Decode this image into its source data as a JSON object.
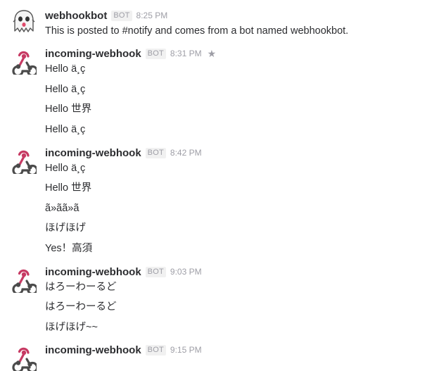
{
  "messages": [
    {
      "sender": "webhookbot",
      "badge": "BOT",
      "time": "8:25 PM",
      "avatar_icon": "ghost-icon",
      "lines": [
        "This is posted to #notify and comes from a bot named webhookbot."
      ]
    },
    {
      "sender": "incoming-webhook",
      "badge": "BOT",
      "time": "8:31 PM",
      "avatar_icon": "webhook-icon",
      "star_icon": "star-icon",
      "lines": [
        "Hello ä¸ç",
        "Hello ä¸ç",
        "Hello 世界",
        "Hello ä¸ç"
      ]
    },
    {
      "sender": "incoming-webhook",
      "badge": "BOT",
      "time": "8:42 PM",
      "avatar_icon": "webhook-icon",
      "lines": [
        "Hello ä¸ç",
        "Hello 世界",
        "ã»ãã»ã",
        "ほげほげ",
        "Yes！高須"
      ]
    },
    {
      "sender": "incoming-webhook",
      "badge": "BOT",
      "time": "9:03 PM",
      "avatar_icon": "webhook-icon",
      "lines": [
        "はろーわーるど",
        "はろーわーるど",
        "ほげほげ~~"
      ]
    },
    {
      "sender": "incoming-webhook",
      "badge": "BOT",
      "time": "9:15 PM",
      "avatar_icon": "webhook-icon",
      "lines": []
    }
  ],
  "colors": {
    "text": "#2c2d30",
    "muted": "#9e9ea6",
    "badge_bg": "#f1f1f1",
    "webhook_red": "#c73a63",
    "webhook_dark": "#4b4b4b"
  }
}
